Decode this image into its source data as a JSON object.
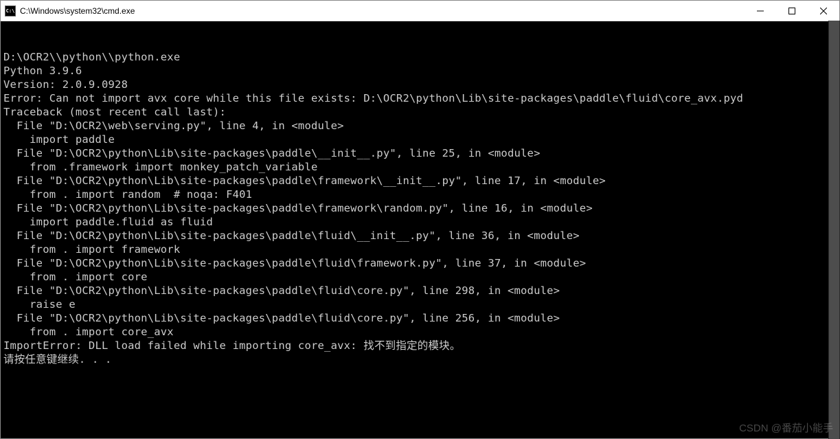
{
  "window": {
    "title": "C:\\Windows\\system32\\cmd.exe",
    "icon_label": "C:\\"
  },
  "terminal": {
    "lines": [
      "D:\\OCR2\\\\python\\\\python.exe",
      "Python 3.9.6",
      "Version: 2.0.9.0928",
      "Error: Can not import avx core while this file exists: D:\\OCR2\\python\\Lib\\site-packages\\paddle\\fluid\\core_avx.pyd",
      "Traceback (most recent call last):",
      "  File \"D:\\OCR2\\web\\serving.py\", line 4, in <module>",
      "    import paddle",
      "  File \"D:\\OCR2\\python\\Lib\\site-packages\\paddle\\__init__.py\", line 25, in <module>",
      "    from .framework import monkey_patch_variable",
      "  File \"D:\\OCR2\\python\\Lib\\site-packages\\paddle\\framework\\__init__.py\", line 17, in <module>",
      "    from . import random  # noqa: F401",
      "  File \"D:\\OCR2\\python\\Lib\\site-packages\\paddle\\framework\\random.py\", line 16, in <module>",
      "    import paddle.fluid as fluid",
      "  File \"D:\\OCR2\\python\\Lib\\site-packages\\paddle\\fluid\\__init__.py\", line 36, in <module>",
      "    from . import framework",
      "  File \"D:\\OCR2\\python\\Lib\\site-packages\\paddle\\fluid\\framework.py\", line 37, in <module>",
      "    from . import core",
      "  File \"D:\\OCR2\\python\\Lib\\site-packages\\paddle\\fluid\\core.py\", line 298, in <module>",
      "    raise e",
      "  File \"D:\\OCR2\\python\\Lib\\site-packages\\paddle\\fluid\\core.py\", line 256, in <module>",
      "    from . import core_avx",
      "ImportError: DLL load failed while importing core_avx: 找不到指定的模块。",
      "请按任意键继续. . ."
    ]
  },
  "watermark": "CSDN @番茄小能手"
}
